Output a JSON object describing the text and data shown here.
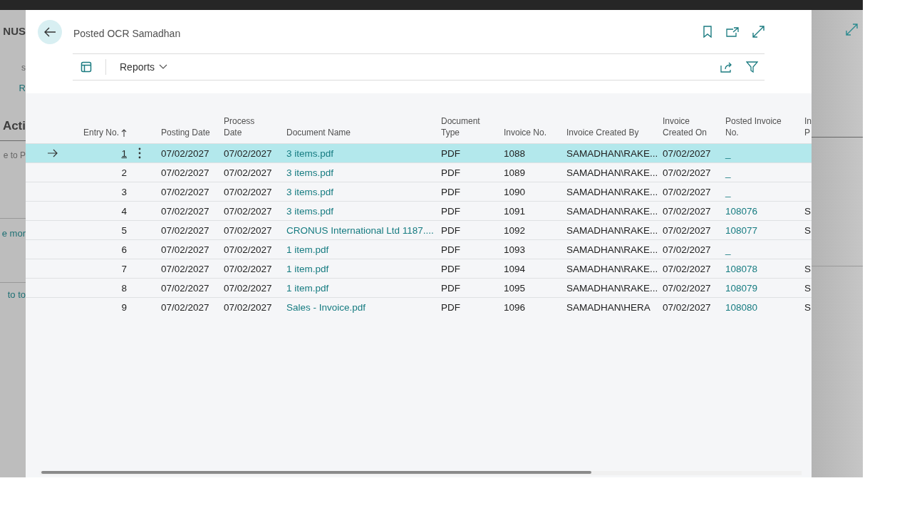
{
  "background_page": {
    "fragments": [
      {
        "text": "NUS",
        "kind": "title"
      },
      {
        "text": "s",
        "kind": "text"
      },
      {
        "text": "R",
        "kind": "link"
      },
      {
        "text": "Acti",
        "kind": "heading"
      },
      {
        "text": "e to P",
        "kind": "text"
      },
      {
        "text": "e mor",
        "kind": "link"
      },
      {
        "text": "to to",
        "kind": "link"
      }
    ]
  },
  "dialog": {
    "title": "Posted OCR Samadhan",
    "action_bar": {
      "menu": "Reports"
    },
    "table": {
      "columns": [
        {
          "label": "Entry No.",
          "sorted_ascending": true
        },
        {
          "label": "Posting Date"
        },
        {
          "label": "Process Date"
        },
        {
          "label": "Document Name"
        },
        {
          "label": "Document Type"
        },
        {
          "label": "Invoice No."
        },
        {
          "label": "Invoice Created By"
        },
        {
          "label": "Invoice Created On"
        },
        {
          "label": "Posted Invoice No."
        },
        {
          "label": "In P"
        }
      ],
      "rows": [
        {
          "selected": true,
          "entry_no": "1",
          "posting_date": "07/02/2027",
          "process_date": "07/02/2027",
          "document_name": "3 items.pdf",
          "document_type": "PDF",
          "invoice_no": "1088",
          "invoice_created_by": "SAMADHAN\\RAKE...",
          "invoice_created_on": "07/02/2027",
          "posted_invoice_no": "_"
        },
        {
          "selected": false,
          "entry_no": "2",
          "posting_date": "07/02/2027",
          "process_date": "07/02/2027",
          "document_name": "3 items.pdf",
          "document_type": "PDF",
          "invoice_no": "1089",
          "invoice_created_by": "SAMADHAN\\RAKE...",
          "invoice_created_on": "07/02/2027",
          "posted_invoice_no": "_"
        },
        {
          "selected": false,
          "entry_no": "3",
          "posting_date": "07/02/2027",
          "process_date": "07/02/2027",
          "document_name": "3 items.pdf",
          "document_type": "PDF",
          "invoice_no": "1090",
          "invoice_created_by": "SAMADHAN\\RAKE...",
          "invoice_created_on": "07/02/2027",
          "posted_invoice_no": "_"
        },
        {
          "selected": false,
          "entry_no": "4",
          "posting_date": "07/02/2027",
          "process_date": "07/02/2027",
          "document_name": "3 items.pdf",
          "document_type": "PDF",
          "invoice_no": "1091",
          "invoice_created_by": "SAMADHAN\\RAKE...",
          "invoice_created_on": "07/02/2027",
          "posted_invoice_no": "108076",
          "column_11": "S"
        },
        {
          "selected": false,
          "entry_no": "5",
          "posting_date": "07/02/2027",
          "process_date": "07/02/2027",
          "document_name": "CRONUS International Ltd 1187....",
          "document_type": "PDF",
          "invoice_no": "1092",
          "invoice_created_by": "SAMADHAN\\RAKE...",
          "invoice_created_on": "07/02/2027",
          "posted_invoice_no": "108077",
          "column_11": "S"
        },
        {
          "selected": false,
          "entry_no": "6",
          "posting_date": "07/02/2027",
          "process_date": "07/02/2027",
          "document_name": "1 item.pdf",
          "document_type": "PDF",
          "invoice_no": "1093",
          "invoice_created_by": "SAMADHAN\\RAKE...",
          "invoice_created_on": "07/02/2027",
          "posted_invoice_no": "_"
        },
        {
          "selected": false,
          "entry_no": "7",
          "posting_date": "07/02/2027",
          "process_date": "07/02/2027",
          "document_name": "1 item.pdf",
          "document_type": "PDF",
          "invoice_no": "1094",
          "invoice_created_by": "SAMADHAN\\RAKE...",
          "invoice_created_on": "07/02/2027",
          "posted_invoice_no": "108078",
          "column_11": "S"
        },
        {
          "selected": false,
          "entry_no": "8",
          "posting_date": "07/02/2027",
          "process_date": "07/02/2027",
          "document_name": "1 item.pdf",
          "document_type": "PDF",
          "invoice_no": "1095",
          "invoice_created_by": "SAMADHAN\\RAKE...",
          "invoice_created_on": "07/02/2027",
          "posted_invoice_no": "108079",
          "column_11": "S"
        },
        {
          "selected": false,
          "entry_no": "9",
          "posting_date": "07/02/2027",
          "process_date": "07/02/2027",
          "document_name": "Sales - Invoice.pdf",
          "document_type": "PDF",
          "invoice_no": "1096",
          "invoice_created_by": "SAMADHAN\\HERA",
          "invoice_created_on": "07/02/2027",
          "posted_invoice_no": "108080",
          "column_11": "S"
        }
      ]
    }
  }
}
